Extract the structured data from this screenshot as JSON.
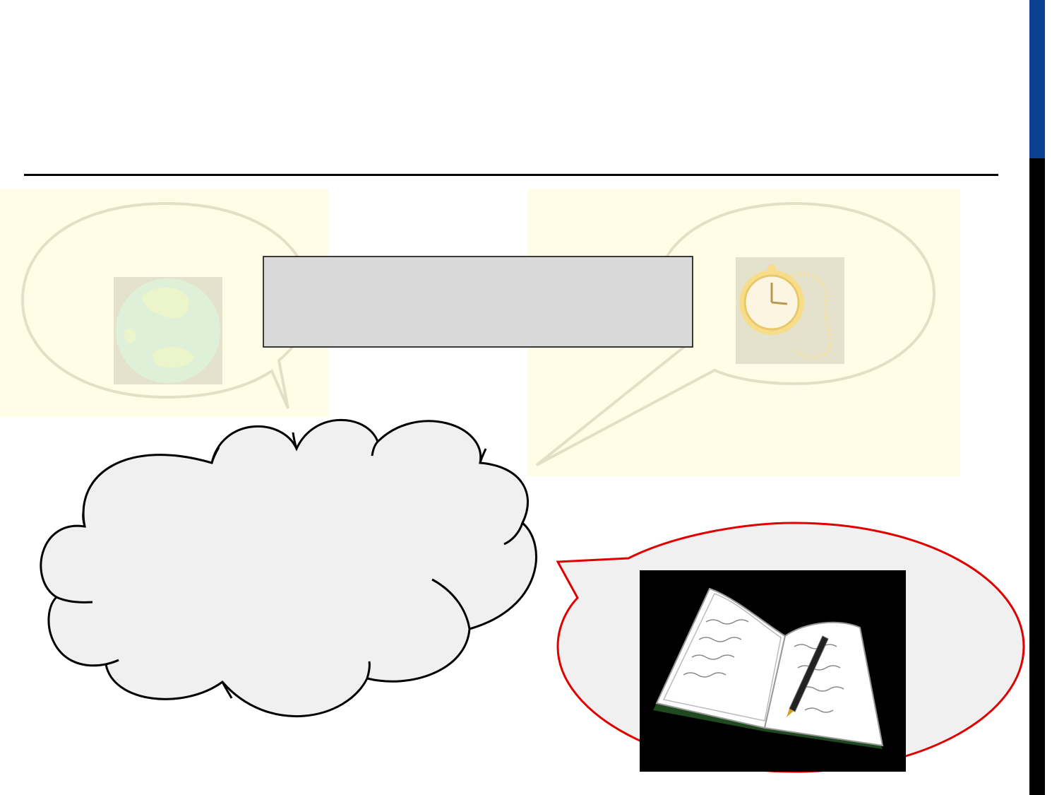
{
  "slide": {
    "title": "",
    "center_box_text": "",
    "cloud_text": ""
  },
  "colors": {
    "accent_blue": "#0b3f8f",
    "sidebar_black": "#000000",
    "panel_fill": "#fffde6",
    "faded_bubble_stroke": "#e3e0c8",
    "center_box_fill": "#d9d9d9",
    "cloud_fill": "#f0f0f0",
    "red_bubble_stroke": "#e00000",
    "red_bubble_fill": "#f0f0f0"
  },
  "icons": {
    "left_bubble": "globe-icon",
    "right_bubble": "pocket-watch-icon",
    "red_bubble": "open-book-pen-icon"
  }
}
